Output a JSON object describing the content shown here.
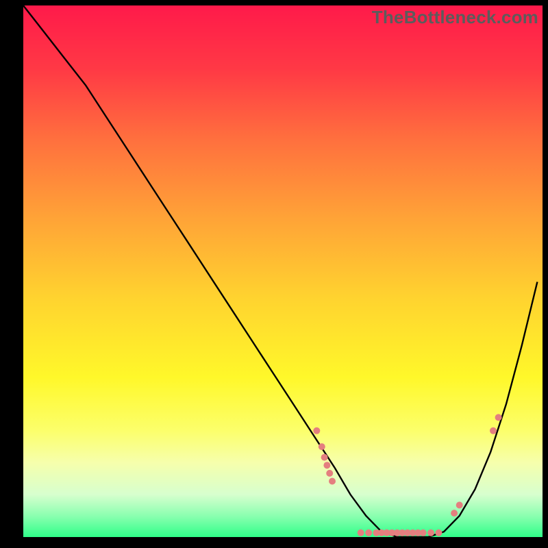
{
  "watermark": "TheBottleneck.com",
  "chart_data": {
    "type": "line",
    "title": "",
    "xlabel": "",
    "ylabel": "",
    "xlim": [
      0,
      100
    ],
    "ylim": [
      0,
      100
    ],
    "grid": false,
    "legend": false,
    "background_gradient_stops": [
      {
        "offset": 0.0,
        "color": "#ff1a4a"
      },
      {
        "offset": 0.12,
        "color": "#ff3945"
      },
      {
        "offset": 0.25,
        "color": "#ff6f3e"
      },
      {
        "offset": 0.4,
        "color": "#ffa337"
      },
      {
        "offset": 0.55,
        "color": "#ffd32f"
      },
      {
        "offset": 0.7,
        "color": "#fff82a"
      },
      {
        "offset": 0.8,
        "color": "#fcff6b"
      },
      {
        "offset": 0.86,
        "color": "#f6ffac"
      },
      {
        "offset": 0.92,
        "color": "#d7ffce"
      },
      {
        "offset": 0.96,
        "color": "#8bffb0"
      },
      {
        "offset": 1.0,
        "color": "#2fff89"
      }
    ],
    "series": [
      {
        "name": "bottleneck-curve",
        "color": "#000000",
        "x": [
          0,
          4,
          8,
          12,
          16,
          20,
          24,
          28,
          32,
          36,
          40,
          44,
          48,
          52,
          56,
          60,
          63,
          66,
          69,
          72,
          75,
          78,
          81,
          84,
          87,
          90,
          93,
          96,
          99
        ],
        "y": [
          100,
          95,
          90,
          85,
          79,
          73,
          67,
          61,
          55,
          49,
          43,
          37,
          31,
          25,
          19,
          13,
          8,
          4,
          1,
          0,
          0,
          0,
          1,
          4,
          9,
          16,
          25,
          36,
          48
        ]
      }
    ],
    "markers": {
      "name": "sample-points",
      "color": "#e47f7f",
      "radius": 5,
      "points": [
        {
          "x": 56.5,
          "y": 20.0
        },
        {
          "x": 57.5,
          "y": 17.0
        },
        {
          "x": 58.0,
          "y": 15.0
        },
        {
          "x": 58.5,
          "y": 13.5
        },
        {
          "x": 59.0,
          "y": 12.0
        },
        {
          "x": 59.5,
          "y": 10.5
        },
        {
          "x": 65.0,
          "y": 0.8
        },
        {
          "x": 66.5,
          "y": 0.8
        },
        {
          "x": 68.0,
          "y": 0.8
        },
        {
          "x": 69.0,
          "y": 0.8
        },
        {
          "x": 70.0,
          "y": 0.8
        },
        {
          "x": 71.0,
          "y": 0.8
        },
        {
          "x": 72.0,
          "y": 0.8
        },
        {
          "x": 73.0,
          "y": 0.8
        },
        {
          "x": 74.0,
          "y": 0.8
        },
        {
          "x": 75.0,
          "y": 0.8
        },
        {
          "x": 76.0,
          "y": 0.8
        },
        {
          "x": 77.0,
          "y": 0.8
        },
        {
          "x": 78.5,
          "y": 0.8
        },
        {
          "x": 80.0,
          "y": 0.8
        },
        {
          "x": 83.0,
          "y": 4.5
        },
        {
          "x": 84.0,
          "y": 6.0
        },
        {
          "x": 90.5,
          "y": 20.0
        },
        {
          "x": 91.5,
          "y": 22.5
        }
      ]
    }
  }
}
